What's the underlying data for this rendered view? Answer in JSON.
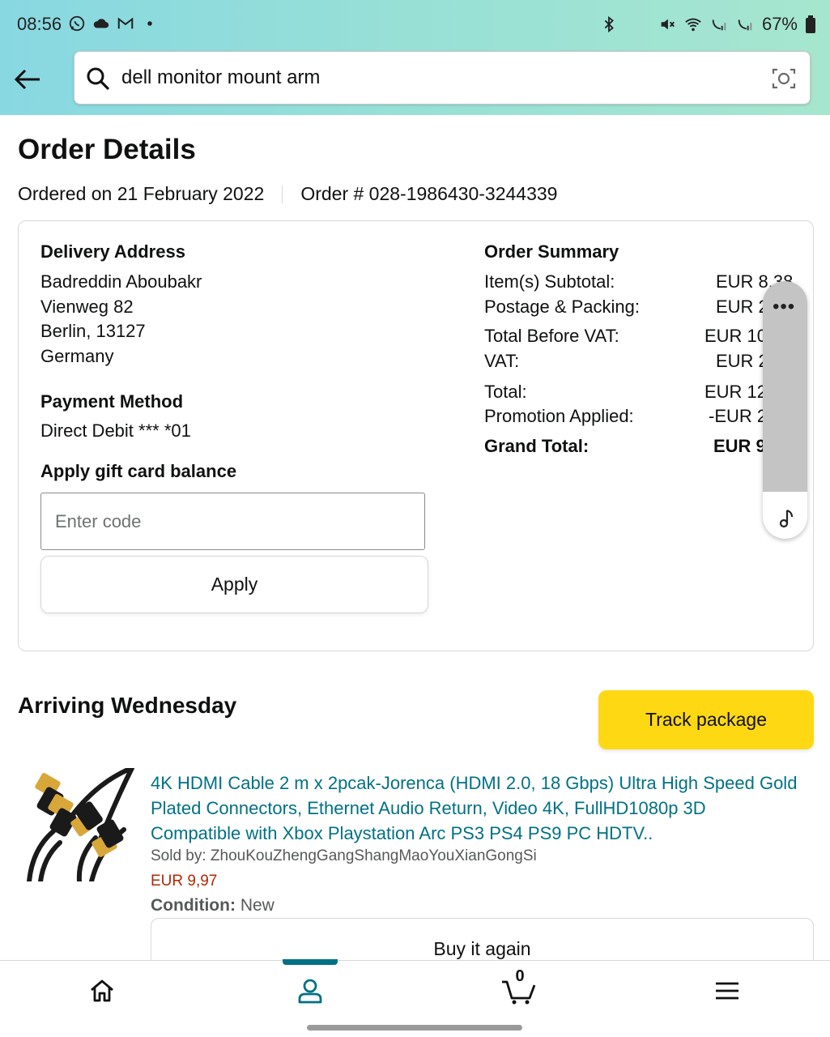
{
  "status_bar": {
    "time": "08:56",
    "battery": "67%",
    "left_icons": [
      "whatsapp-icon",
      "cloud-icon",
      "gmail-icon",
      "dot-icon"
    ],
    "right_icons": [
      "bluetooth-icon",
      "mute-icon",
      "wifi-icon",
      "call-signal-1-icon",
      "call-signal-2-icon",
      "battery-icon"
    ]
  },
  "search": {
    "query": "dell monitor mount arm"
  },
  "page": {
    "title": "Order Details",
    "ordered_on": "Ordered on 21 February 2022",
    "order_number": "Order # 028-1986430-3244339"
  },
  "delivery": {
    "heading": "Delivery Address",
    "name": "Badreddin Aboubakr",
    "street": "Vienweg 82",
    "city": "Berlin, 13127",
    "country": "Germany"
  },
  "payment": {
    "heading": "Payment Method",
    "method": "Direct Debit *** *01"
  },
  "gift_card": {
    "heading": "Apply gift card balance",
    "placeholder": "Enter code",
    "apply_label": "Apply"
  },
  "summary": {
    "heading": "Order Summary",
    "rows": [
      {
        "label": "Item(s) Subtotal:",
        "value": "EUR 8,38"
      },
      {
        "label": "Postage & Packing:",
        "value": "EUR 2"
      },
      {
        "label": "Total Before VAT:",
        "value": "EUR 10"
      },
      {
        "label": "VAT:",
        "value": "EUR 2"
      },
      {
        "label": "Total:",
        "value": "EUR 12"
      },
      {
        "label": "Promotion Applied:",
        "value": "-EUR 2"
      },
      {
        "label": "Grand Total:",
        "value": "EUR 9"
      }
    ]
  },
  "floating_panel": {
    "menu_glyph": "•••"
  },
  "shipment": {
    "heading": "Arriving Wednesday",
    "track_label": "Track package",
    "product_title": "4K HDMI Cable 2 m x 2pcak-Jorenca (HDMI 2.0, 18 Gbps) Ultra High Speed Gold Plated Connectors, Ethernet Audio Return, Video 4K, FullHD1080p 3D Compatible with Xbox Playstation Arc PS3 PS4 PS9 PC HDTV..",
    "sold_by": "Sold by: ZhouKouZhengGangShangMaoYouXianGongSi",
    "price": "EUR 9,97",
    "condition_label": "Condition:",
    "condition_value": "New",
    "buy_again_label": "Buy it again"
  },
  "bottom_nav": {
    "cart_count": "0",
    "active": "account",
    "accent_color": "#007185"
  },
  "colors": {
    "link": "#007185",
    "price": "#b12704",
    "track_button": "#ffd814"
  }
}
